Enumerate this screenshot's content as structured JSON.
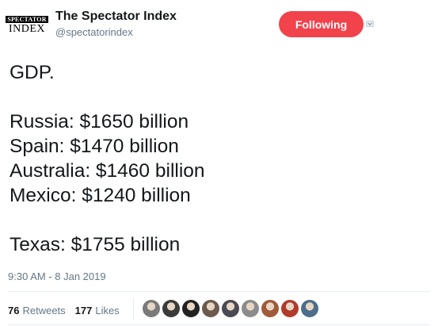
{
  "author": {
    "avatar_top": "SPECTATOR",
    "avatar_bottom": "INDEX",
    "display_name": "The Spectator Index",
    "handle": "@spectatorindex"
  },
  "follow_button": {
    "label": "Following",
    "color": "#f2424b"
  },
  "tweet": {
    "lines": [
      "GDP.",
      "",
      "Russia: $1650 billion",
      "Spain: $1470 billion",
      "Australia: $1460 billion",
      "Mexico: $1240 billion",
      "",
      "Texas: $1755 billion"
    ],
    "timestamp": "9:30 AM - 8 Jan 2019"
  },
  "stats": {
    "retweets_count": "76",
    "retweets_label": "Retweets",
    "likes_count": "177",
    "likes_label": "Likes"
  },
  "likers": [
    {
      "name": "liker-1",
      "color": "#7a7a7a"
    },
    {
      "name": "liker-2",
      "color": "#3a3a3a"
    },
    {
      "name": "liker-3",
      "color": "#222222"
    },
    {
      "name": "liker-4",
      "color": "#6b5a4e"
    },
    {
      "name": "liker-5",
      "color": "#4a4a55"
    },
    {
      "name": "liker-6",
      "color": "#8c8c8c"
    },
    {
      "name": "liker-7",
      "color": "#a05a3a"
    },
    {
      "name": "liker-8",
      "color": "#b23a2a"
    },
    {
      "name": "liker-9",
      "color": "#4c6e8a"
    }
  ]
}
